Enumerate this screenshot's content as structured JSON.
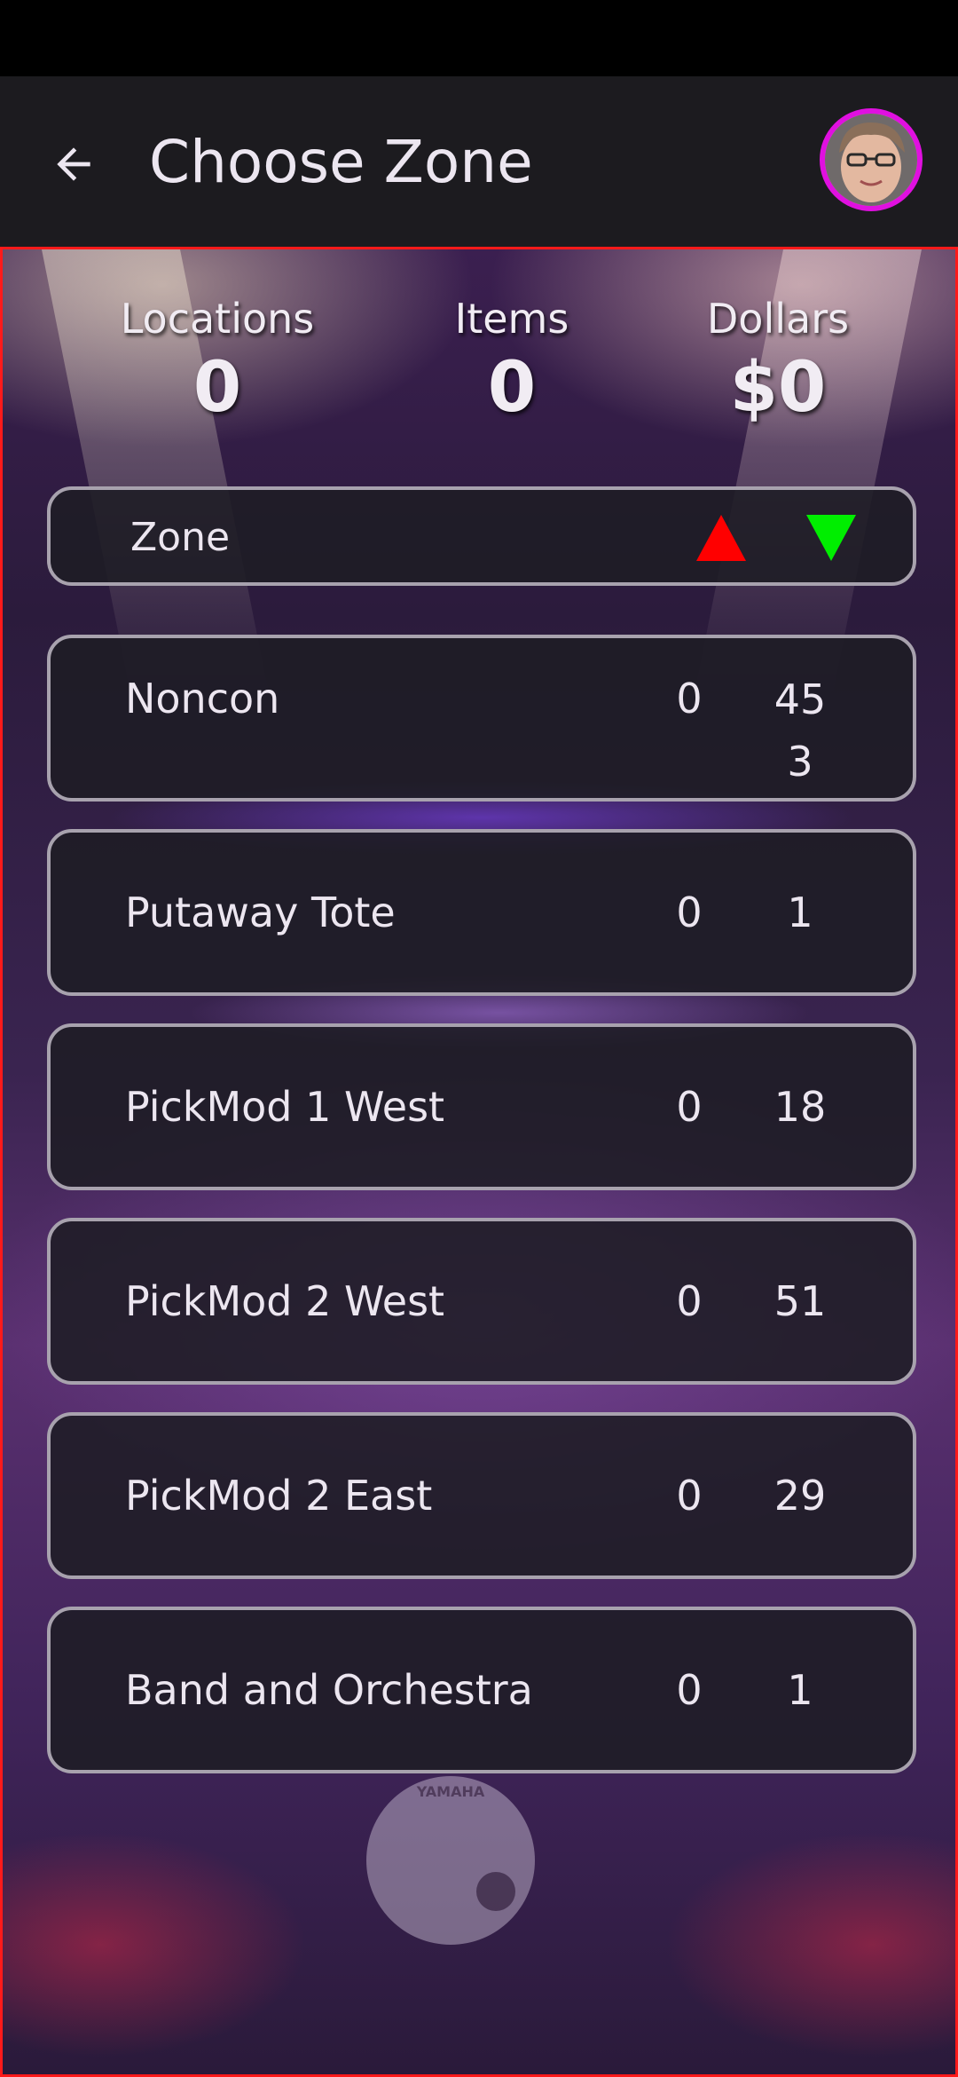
{
  "header": {
    "title": "Choose Zone",
    "back_icon": "arrow-left-icon",
    "avatar_icon": "user-avatar"
  },
  "colors": {
    "accent_border": "#ff1a1a",
    "avatar_ring": "#e010e0",
    "sort_up": "#ff0000",
    "sort_down": "#00ee00",
    "row_border": "#a8a2ae"
  },
  "summary": {
    "locations_label": "Locations",
    "locations_value": "0",
    "items_label": "Items",
    "items_value": "0",
    "dollars_label": "Dollars",
    "dollars_value": "$0"
  },
  "zone_header": {
    "label": "Zone",
    "sort_up_icon": "triangle-up-icon",
    "sort_down_icon": "triangle-down-icon"
  },
  "zones": [
    {
      "name": "Noncon",
      "locations": "0",
      "items": "453"
    },
    {
      "name": "Putaway Tote",
      "locations": "0",
      "items": "1"
    },
    {
      "name": "PickMod 1 West",
      "locations": "0",
      "items": "18"
    },
    {
      "name": "PickMod 2 West",
      "locations": "0",
      "items": "51"
    },
    {
      "name": "PickMod 2 East",
      "locations": "0",
      "items": "29"
    },
    {
      "name": "Band and Orchestra",
      "locations": "0",
      "items": "1"
    }
  ],
  "background": {
    "drum_brand": "YAMAHA"
  }
}
